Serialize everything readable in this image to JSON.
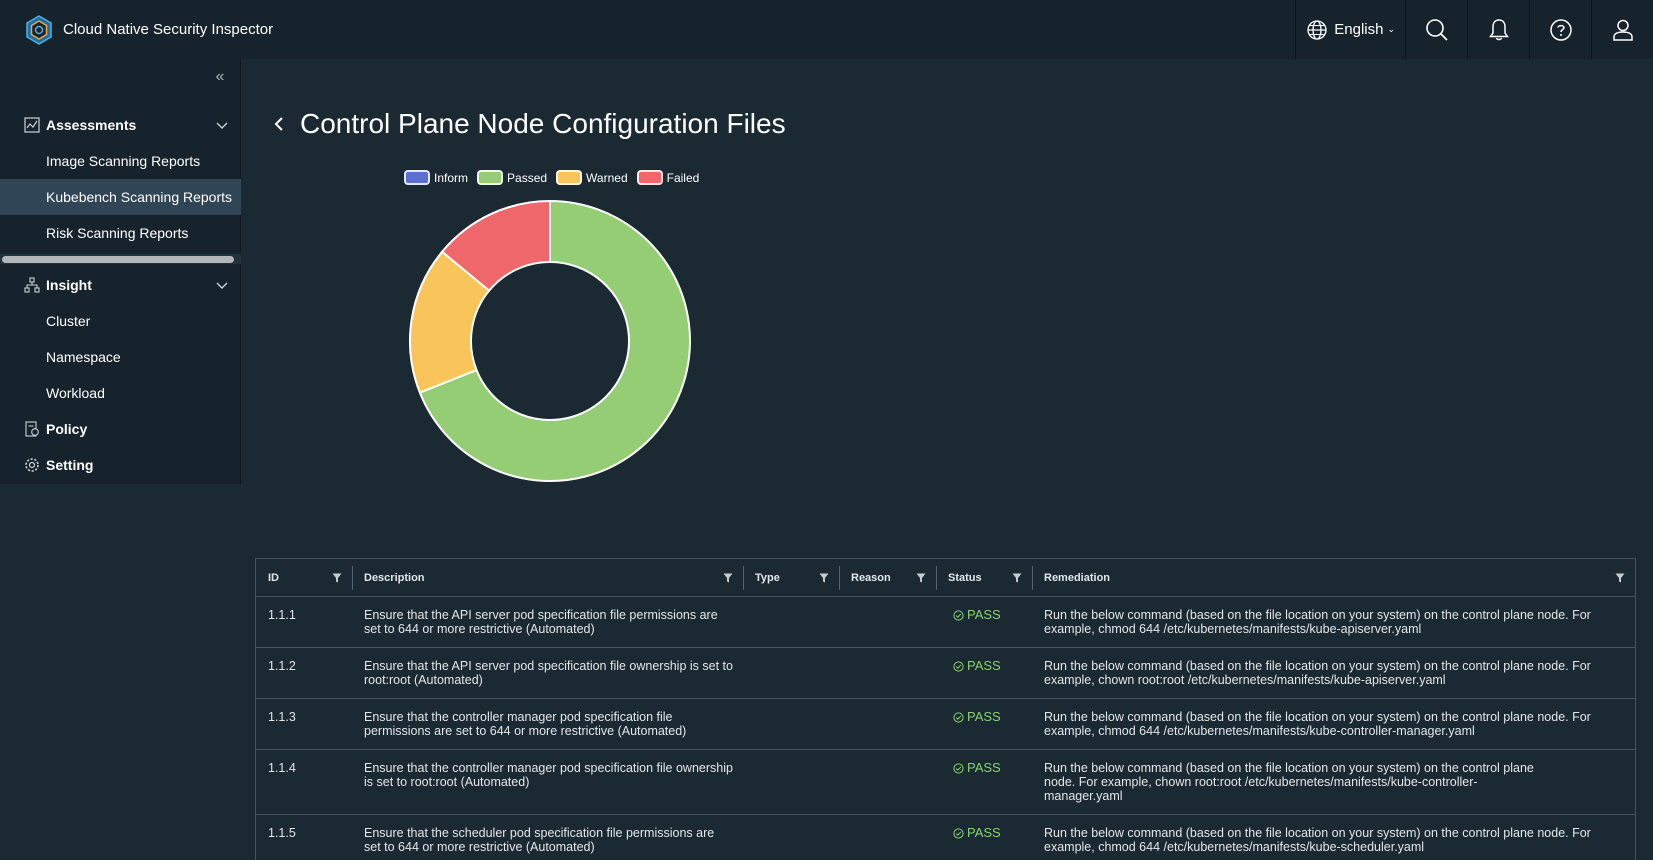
{
  "app": {
    "title": "Cloud Native Security Inspector"
  },
  "header": {
    "language": "English",
    "icons": [
      "globe-icon",
      "search-icon",
      "bell-icon",
      "help-icon",
      "user-icon"
    ]
  },
  "sidebar": {
    "sections": [
      {
        "label": "Assessments",
        "icon": "chart-icon",
        "expanded": true,
        "items": [
          "Image Scanning Reports",
          "Kubebench Scanning Reports",
          "Risk Scanning Reports"
        ]
      },
      {
        "label": "Insight",
        "icon": "hierarchy-icon",
        "expanded": true,
        "items": [
          "Cluster",
          "Namespace",
          "Workload"
        ]
      },
      {
        "label": "Policy",
        "icon": "policy-icon"
      },
      {
        "label": "Setting",
        "icon": "gear-icon"
      }
    ],
    "active_item": "Kubebench Scanning Reports"
  },
  "page": {
    "title": "Control Plane Node Configuration Files"
  },
  "chart_data": {
    "type": "doughnut",
    "legend": [
      {
        "name": "Inform",
        "color": "#5a6fd0"
      },
      {
        "name": "Passed",
        "color": "#94cd74"
      },
      {
        "name": "Warned",
        "color": "#f9c55a"
      },
      {
        "name": "Failed",
        "color": "#ef666b"
      }
    ],
    "legend_position": "top",
    "series": [
      {
        "name": "Inform",
        "value": 0
      },
      {
        "name": "Passed",
        "value": 69
      },
      {
        "name": "Warned",
        "value": 17
      },
      {
        "name": "Failed",
        "value": 14
      }
    ]
  },
  "table": {
    "columns": [
      "ID",
      "Description",
      "Type",
      "Reason",
      "Status",
      "Remediation"
    ],
    "rows": [
      {
        "id": "1.1.1",
        "description": "Ensure that the API server pod specification file permissions are set to 644 or more restrictive (Automated)",
        "type": "",
        "reason": "",
        "status": "PASS",
        "remediation": "Run the below command (based on the file location on your system) on the control plane node. For example, chmod 644 /etc/kubernetes/manifests/kube-apiserver.yaml"
      },
      {
        "id": "1.1.2",
        "description": "Ensure that the API server pod specification file ownership is set to root:root (Automated)",
        "type": "",
        "reason": "",
        "status": "PASS",
        "remediation": "Run the below command (based on the file location on your system) on the control plane node. For example, chown root:root /etc/kubernetes/manifests/kube-apiserver.yaml"
      },
      {
        "id": "1.1.3",
        "description": "Ensure that the controller manager pod specification file permissions are set to 644 or more restrictive (Automated)",
        "type": "",
        "reason": "",
        "status": "PASS",
        "remediation": "Run the below command (based on the file location on your system) on the control plane node. For example, chmod 644 /etc/kubernetes/manifests/kube-controller-manager.yaml"
      },
      {
        "id": "1.1.4",
        "description": "Ensure that the controller manager pod specification file ownership is set to root:root (Automated)",
        "type": "",
        "reason": "",
        "status": "PASS",
        "remediation": "Run the below command (based on the file location on your system) on the control plane node. For example, chown root:root /etc/kubernetes/manifests/kube-controller-manager.yaml"
      },
      {
        "id": "1.1.5",
        "description": "Ensure that the scheduler pod specification file permissions are set to 644 or more restrictive (Automated)",
        "type": "",
        "reason": "",
        "status": "PASS",
        "remediation": "Run the below command (based on the file location on your system) on the control plane node. For example, chmod 644 /etc/kubernetes/manifests/kube-scheduler.yaml"
      }
    ]
  }
}
